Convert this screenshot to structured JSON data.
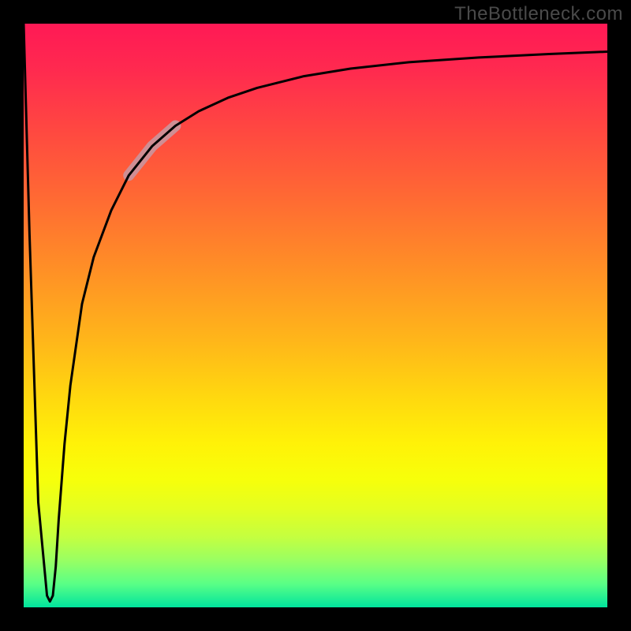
{
  "attribution": "TheBottleneck.com",
  "chart_data": {
    "type": "line",
    "title": "",
    "xlabel": "",
    "ylabel": "",
    "x_range": [
      0,
      100
    ],
    "y_range": [
      0,
      100
    ],
    "series": [
      {
        "name": "bottleneck-curve",
        "x": [
          0,
          1,
          2.5,
          4,
          4.5,
          5,
          5.5,
          6,
          7,
          8,
          10,
          12,
          15,
          18,
          22,
          26,
          30,
          35,
          40,
          48,
          56,
          66,
          78,
          90,
          100
        ],
        "y": [
          100,
          64,
          18,
          2,
          1,
          2,
          7,
          15,
          28,
          38,
          52,
          60,
          68,
          74,
          79,
          82.5,
          85,
          87.3,
          89,
          91,
          92.3,
          93.4,
          94.2,
          94.8,
          95.2
        ]
      }
    ],
    "highlight_segment": {
      "x_start": 18,
      "x_end": 26
    },
    "gradient_stops": [
      {
        "pos": 0,
        "color": "#ff1955"
      },
      {
        "pos": 50,
        "color": "#ffd80f"
      },
      {
        "pos": 78,
        "color": "#f7ff0a"
      },
      {
        "pos": 100,
        "color": "#00e49d"
      }
    ]
  }
}
